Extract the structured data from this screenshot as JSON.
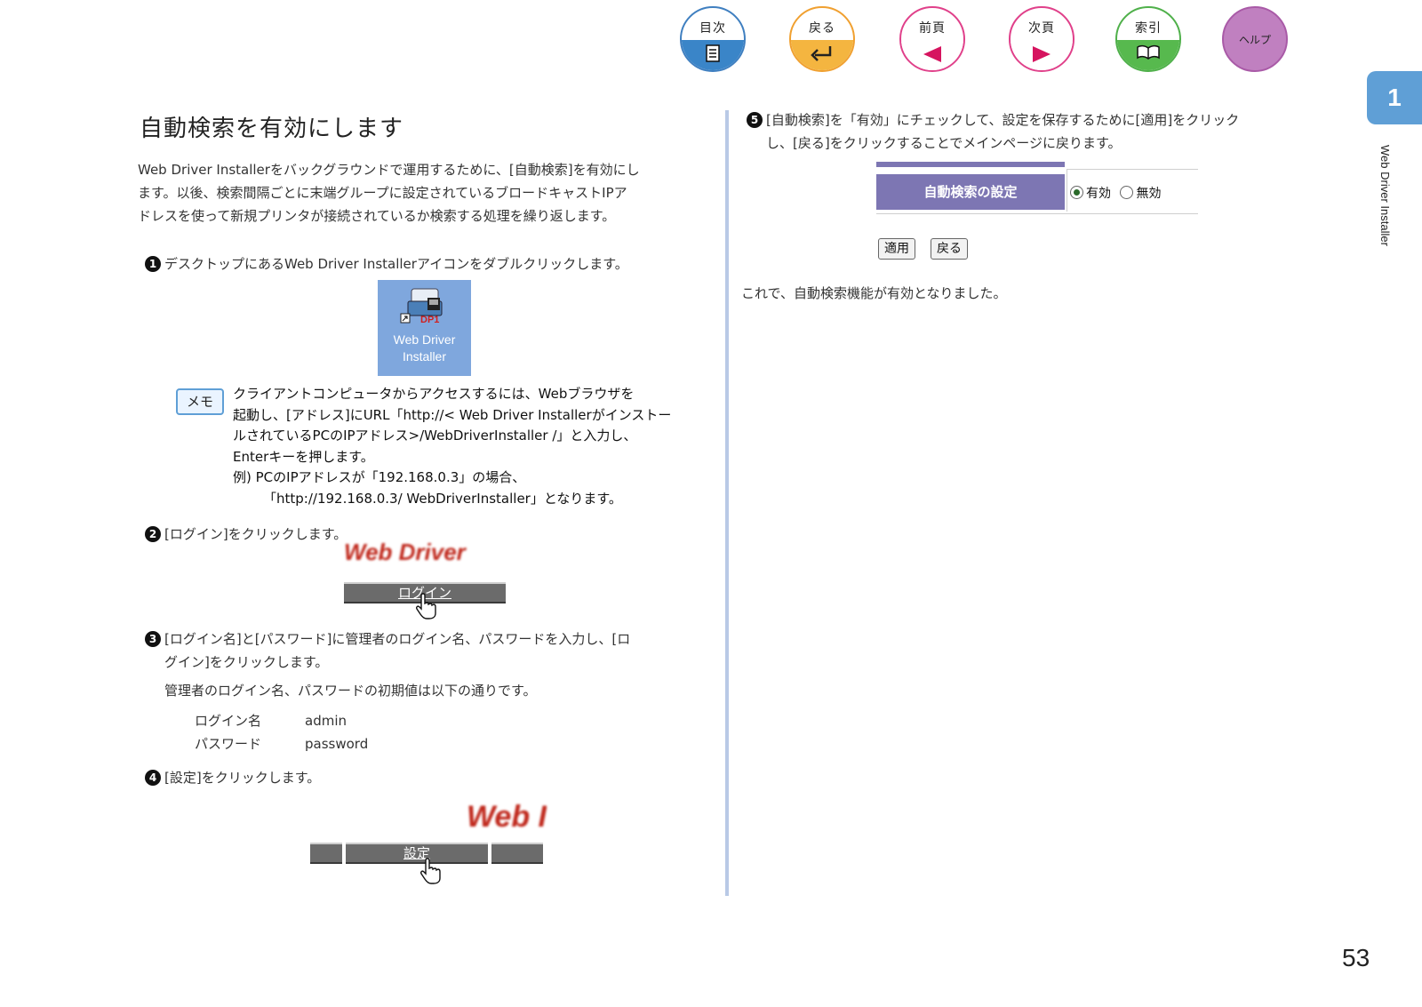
{
  "nav": [
    {
      "label": "目次",
      "color": "#3f7fc0",
      "fill": "#3a85c8",
      "icon": "document-icon"
    },
    {
      "label": "戻る",
      "color": "#f0a030",
      "fill": "#f4b540",
      "icon": "return-arrow-icon"
    },
    {
      "label": "前頁",
      "color": "#e0408a",
      "fill": "#ffffff",
      "icon": "left-triangle-icon"
    },
    {
      "label": "次頁",
      "color": "#e0408a",
      "fill": "#ffffff",
      "icon": "right-triangle-icon"
    },
    {
      "label": "索引",
      "color": "#4fb04a",
      "fill": "#57b94e",
      "icon": "book-icon"
    },
    {
      "label": "ヘルプ",
      "color": "#a95aa7",
      "fill": "#c080c0",
      "icon": ""
    }
  ],
  "chapter_number": "1",
  "side_title": "Web Driver Installer",
  "page_number": "53",
  "heading": "自動検索を有効にします",
  "intro_lines": [
    "Web Driver Installerをバックグラウンドで運用するために、[自動検索]を有効にし",
    "ます。以後、検索間隔ごとに末端グループに設定されているブロードキャストIPア",
    "ドレスを使って新規プリンタが接続されているか検索する処理を繰り返します。"
  ],
  "steps": {
    "s1": {
      "num": "1",
      "text": "デスクトップにあるWeb Driver Installerアイコンをダブルクリックします。"
    },
    "s2": {
      "num": "2",
      "text": "[ログイン]をクリックします。"
    },
    "s3": {
      "num": "3",
      "line1": "[ログイン名]と[パスワード]に管理者のログイン名、パスワードを入力し、[ロ",
      "line2": "グイン]をクリックします。"
    },
    "s4": {
      "num": "4",
      "text": "[設定]をクリックします。"
    },
    "s5": {
      "num": "5",
      "line1": "[自動検索]を「有効」にチェックして、設定を保存するために[適用]をクリック",
      "line2": "し、[戻る]をクリックすることでメインページに戻ります。"
    }
  },
  "desktop_icon": {
    "line1": "Web Driver",
    "line2": "Installer"
  },
  "memo": {
    "badge": "メモ",
    "lines": [
      "クライアントコンピュータからアクセスするには、Webブラウザを",
      "起動し、[アドレス]にURL「http://< Web Driver Installerがインストー",
      "ルされているPCのIPアドレス>/WebDriverInstaller /」と入力し、",
      "Enterキーを押します。",
      "例) PCのIPアドレスが「192.168.0.3」の場合、",
      "「http://192.168.0.3/ WebDriverInstaller」となります。"
    ]
  },
  "login_shot": {
    "banner": "Web Driver",
    "button": "ログイン"
  },
  "defaults_intro": "管理者のログイン名、パスワードの初期値は以下の通りです。",
  "defaults": [
    {
      "key": "ログイン名",
      "value": "admin"
    },
    {
      "key": "パスワード",
      "value": "password"
    }
  ],
  "setting_shot": {
    "banner": "Web I",
    "button": "設定"
  },
  "auto_search": {
    "label": "自動検索の設定",
    "on": "有効",
    "off": "無効",
    "selected": "有効"
  },
  "buttons": {
    "apply": "適用",
    "back": "戻る"
  },
  "conclusion": "これで、自動検索機能が有効となりました。"
}
